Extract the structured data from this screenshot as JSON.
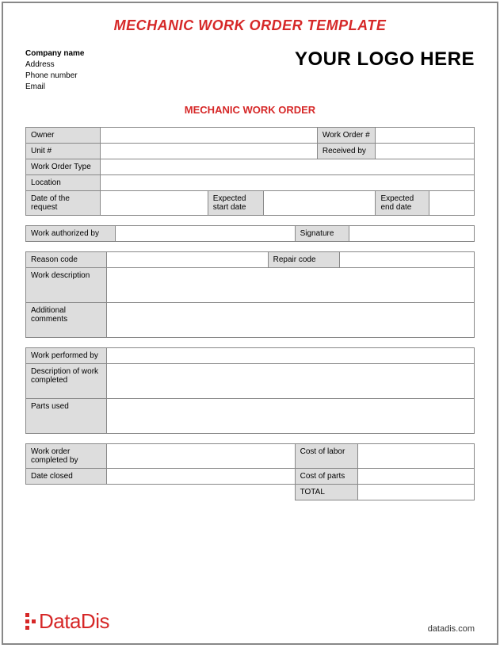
{
  "main_title": "MECHANIC WORK ORDER TEMPLATE",
  "company": {
    "name_label": "Company name",
    "address_label": "Address",
    "phone_label": "Phone number",
    "email_label": "Email"
  },
  "logo_placeholder": "YOUR LOGO HERE",
  "sub_title": "MECHANIC WORK ORDER",
  "fields": {
    "owner": "Owner",
    "work_order_num": "Work Order #",
    "unit_num": "Unit #",
    "received_by": "Received by",
    "work_order_type": "Work Order Type",
    "location": "Location",
    "date_of_request": "Date of the request",
    "expected_start": "Expected start date",
    "expected_end": "Expected end date",
    "work_authorized_by": "Work authorized by",
    "signature": "Signature",
    "reason_code": "Reason code",
    "repair_code": "Repair code",
    "work_description": "Work description",
    "additional_comments": "Additional comments",
    "work_performed_by": "Work performed by",
    "description_completed": "Description of work completed",
    "parts_used": "Parts used",
    "work_order_completed_by": "Work order completed by",
    "cost_of_labor": "Cost of labor",
    "date_closed": "Date closed",
    "cost_of_parts": "Cost of parts",
    "total": "TOTAL"
  },
  "footer": {
    "brand": "DataDis",
    "site": "datadis.com"
  }
}
